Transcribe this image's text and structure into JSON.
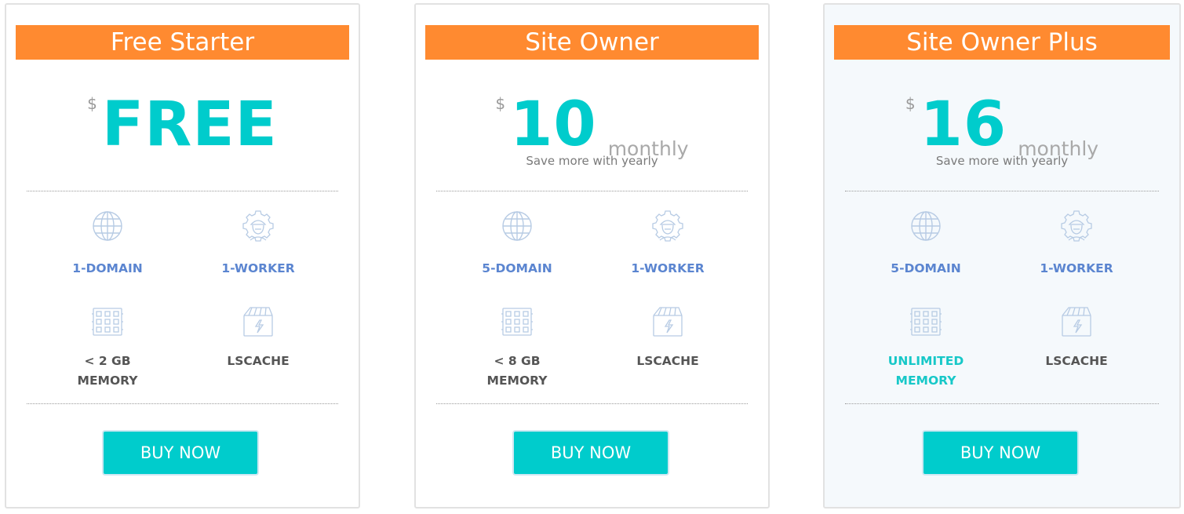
{
  "plans": [
    {
      "name": "Free Starter",
      "currency": "$",
      "price": "FREE",
      "period": "",
      "note": "",
      "features": [
        {
          "icon": "globe-icon",
          "label": "1-DOMAIN"
        },
        {
          "icon": "worker-icon",
          "label": "1-WORKER"
        },
        {
          "icon": "memory-icon",
          "label": "< 2 GB\nMEMORY"
        },
        {
          "icon": "lscache-icon",
          "label": "LSCACHE"
        }
      ],
      "button": "BUY NOW"
    },
    {
      "name": "Site Owner",
      "currency": "$",
      "price": "10",
      "period": "monthly",
      "note": "Save more with yearly",
      "features": [
        {
          "icon": "globe-icon",
          "label": "5-DOMAIN"
        },
        {
          "icon": "worker-icon",
          "label": "1-WORKER"
        },
        {
          "icon": "memory-icon",
          "label": "< 8 GB\nMEMORY"
        },
        {
          "icon": "lscache-icon",
          "label": "LSCACHE"
        }
      ],
      "button": "BUY NOW"
    },
    {
      "name": "Site Owner Plus",
      "currency": "$",
      "price": "16",
      "period": "monthly",
      "note": "Save more with yearly",
      "features": [
        {
          "icon": "globe-icon",
          "label": "5-DOMAIN"
        },
        {
          "icon": "worker-icon",
          "label": "1-WORKER"
        },
        {
          "icon": "memory-icon",
          "label": "UNLIMITED\nMEMORY"
        },
        {
          "icon": "lscache-icon",
          "label": "LSCACHE"
        }
      ],
      "button": "BUY NOW"
    }
  ],
  "colors": {
    "banner": "#ff8a30",
    "price": "#00cccc",
    "button": "#00cccc",
    "feature_link": "#5b85d0",
    "feature_text": "#555555",
    "highlight_text": "#17c8c8"
  }
}
